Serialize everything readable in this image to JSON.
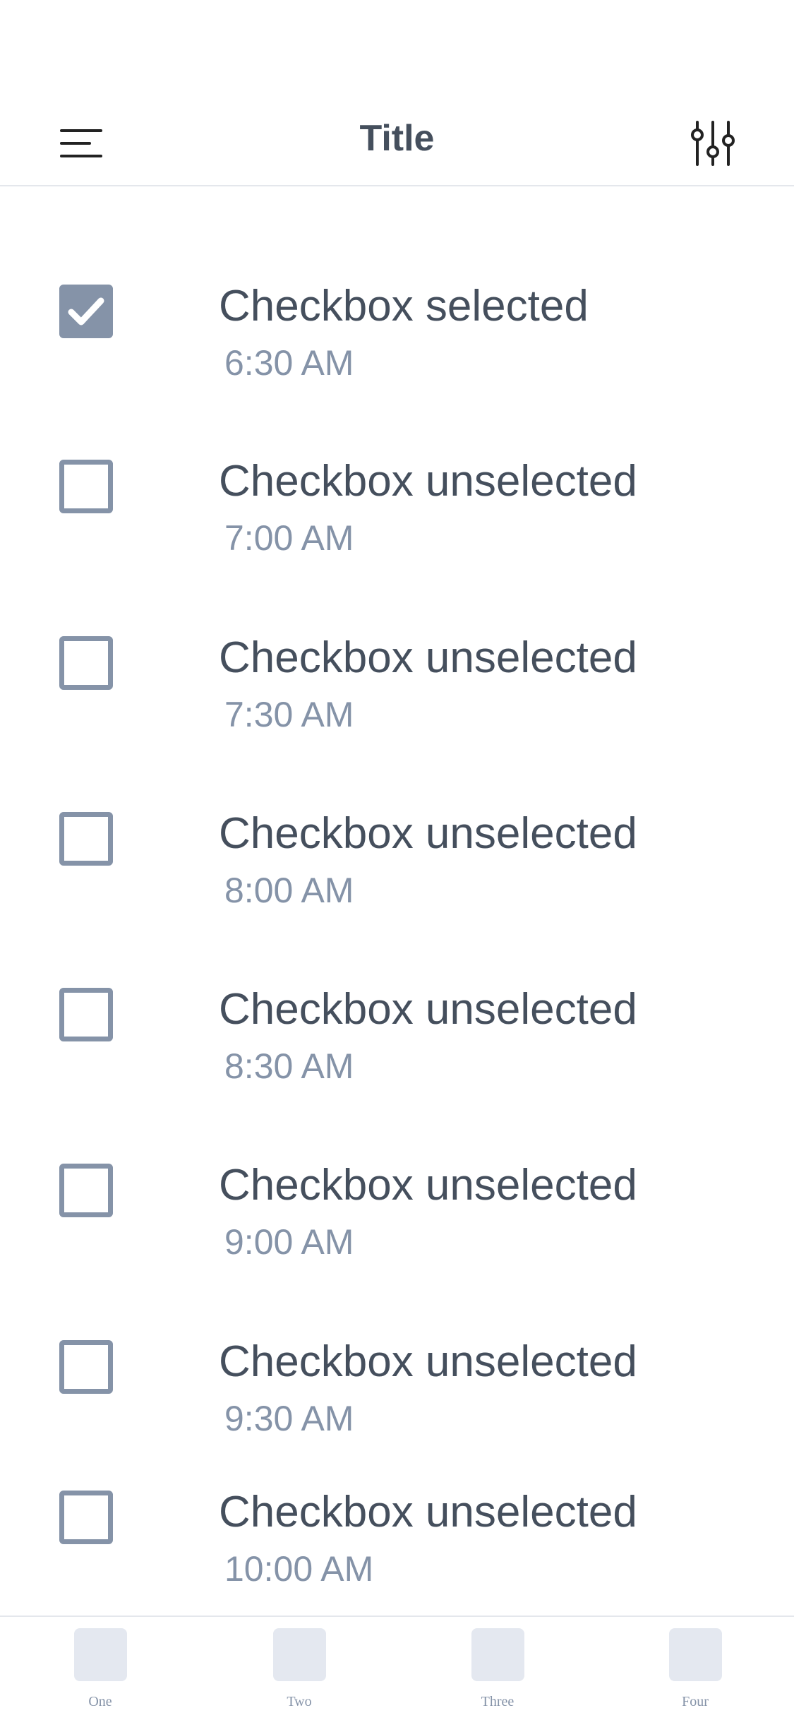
{
  "header": {
    "title": "Title",
    "left_icon": "menu-icon",
    "right_icon": "sliders-icon"
  },
  "colors": {
    "text_primary": "#454f5d",
    "text_secondary": "#8593a8",
    "checkbox": "#8593a8",
    "divider": "#e4e7ec",
    "tab_icon_bg": "#e4e8f0"
  },
  "items": [
    {
      "label": "Checkbox selected",
      "time": "6:30 AM",
      "checked": true
    },
    {
      "label": "Checkbox unselected",
      "time": "7:00 AM",
      "checked": false
    },
    {
      "label": "Checkbox unselected",
      "time": "7:30 AM",
      "checked": false
    },
    {
      "label": "Checkbox unselected",
      "time": "8:00 AM",
      "checked": false
    },
    {
      "label": "Checkbox unselected",
      "time": "8:30 AM",
      "checked": false
    },
    {
      "label": "Checkbox unselected",
      "time": "9:00 AM",
      "checked": false
    },
    {
      "label": "Checkbox unselected",
      "time": "9:30 AM",
      "checked": false
    },
    {
      "label": "Checkbox unselected",
      "time": "10:00 AM",
      "checked": false
    }
  ],
  "tabs": [
    {
      "label": "One"
    },
    {
      "label": "Two"
    },
    {
      "label": "Three"
    },
    {
      "label": "Four"
    }
  ]
}
